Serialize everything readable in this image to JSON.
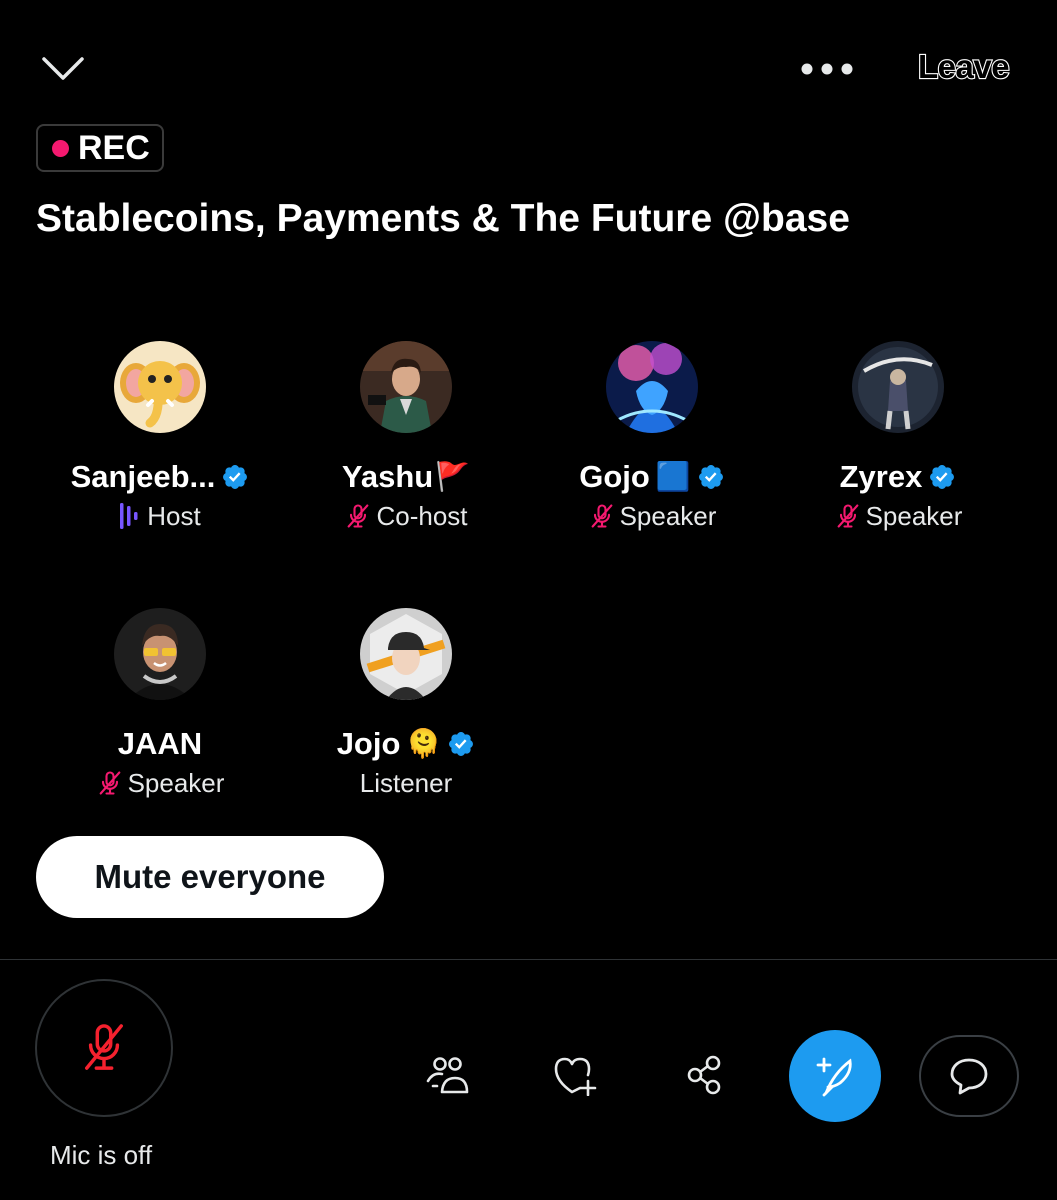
{
  "header": {
    "collapse_icon": "chevron-down-icon",
    "more_icon": "more-horizontal-icon",
    "leave_label": "Leave"
  },
  "recording": {
    "label": "REC",
    "dot_color": "#f4196f"
  },
  "space": {
    "title": "Stablecoins, Payments & The Future @base"
  },
  "participants": [
    {
      "name": "Sanjeeb...",
      "role": "Host",
      "verified": true,
      "role_icon": "speaking-waveform-icon"
    },
    {
      "name": "Yashu",
      "name_suffix": "🚩",
      "role": "Co-host",
      "verified": false,
      "role_icon": "mic-off-icon"
    },
    {
      "name": "Gojo",
      "name_suffix": "🟦",
      "role": "Speaker",
      "verified": true,
      "role_icon": "mic-off-icon"
    },
    {
      "name": "Zyrex",
      "role": "Speaker",
      "verified": true,
      "role_icon": "mic-off-icon"
    },
    {
      "name": "JAAN",
      "role": "Speaker",
      "verified": false,
      "role_icon": "mic-off-icon"
    },
    {
      "name": "Jojo",
      "name_suffix": "🫠",
      "role": "Listener",
      "verified": true
    }
  ],
  "actions": {
    "mute_everyone_label": "Mute everyone"
  },
  "bottom_bar": {
    "mic_label": "Mic is off",
    "mic_icon": "mic-off-icon",
    "people_icon": "people-icon",
    "react_icon": "heart-plus-icon",
    "share_icon": "share-icon",
    "compose_icon": "compose-tweet-icon",
    "chat_icon": "chat-bubble-icon"
  },
  "colors": {
    "accent": "#1d9bf0",
    "mic_off": "#f4196f",
    "speaking": "#7856ff",
    "background": "#000000"
  }
}
